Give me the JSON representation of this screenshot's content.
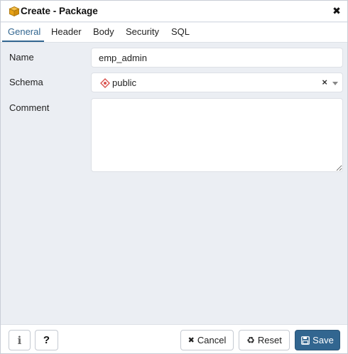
{
  "dialog": {
    "title": "Create - Package",
    "close_symbol": "✖"
  },
  "tabs": [
    {
      "label": "General",
      "active": true
    },
    {
      "label": "Header",
      "active": false
    },
    {
      "label": "Body",
      "active": false
    },
    {
      "label": "Security",
      "active": false
    },
    {
      "label": "SQL",
      "active": false
    }
  ],
  "form": {
    "name": {
      "label": "Name",
      "value": "emp_admin"
    },
    "schema": {
      "label": "Schema",
      "value": "public",
      "clear_symbol": "×"
    },
    "comment": {
      "label": "Comment",
      "value": ""
    }
  },
  "footer": {
    "info_symbol": "i",
    "help_symbol": "?",
    "cancel_label": "Cancel",
    "cancel_symbol": "✖",
    "reset_label": "Reset",
    "reset_symbol": "♻",
    "save_label": "Save"
  },
  "colors": {
    "accent": "#326690",
    "panel_background": "#ebeef3",
    "package_icon": "#e8a317",
    "schema_icon": "#d9534f"
  },
  "icons": {
    "title": "package-icon",
    "schema": "schema-icon",
    "info": "info-icon",
    "help": "help-icon",
    "cancel": "times-icon",
    "reset": "recycle-icon",
    "save": "floppy-disk-icon"
  }
}
